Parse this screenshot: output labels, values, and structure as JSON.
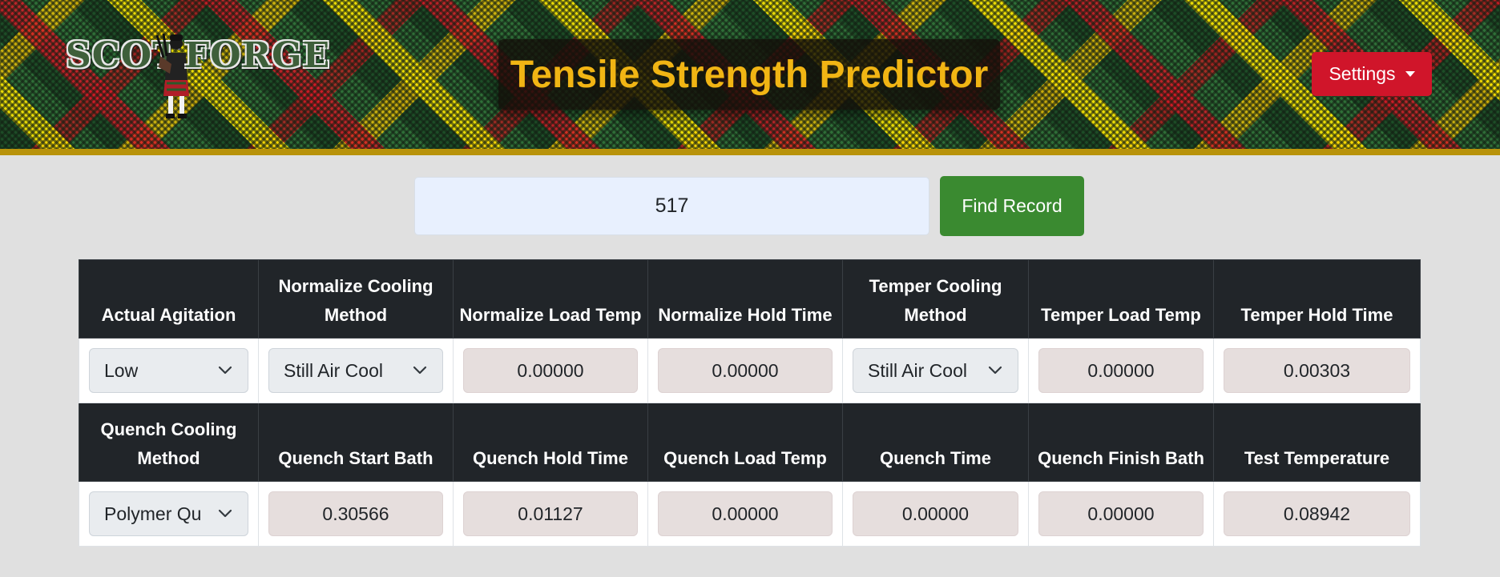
{
  "header": {
    "logo_text_left": "SCOT",
    "logo_text_right": "FORGE",
    "title": "Tensile Strength Predictor",
    "settings_label": "Settings"
  },
  "search": {
    "value": "517",
    "button_label": "Find Record"
  },
  "table": {
    "row1_headers": [
      "Actual Agitation",
      "Normalize Cooling Method",
      "Normalize Load Temp",
      "Normalize Hold Time",
      "Temper Cooling Method",
      "Temper Load Temp",
      "Temper Hold Time"
    ],
    "row1_values": [
      {
        "type": "select",
        "value": "Low"
      },
      {
        "type": "select",
        "value": "Still Air Cool"
      },
      {
        "type": "number",
        "value": "0.00000"
      },
      {
        "type": "number",
        "value": "0.00000"
      },
      {
        "type": "select",
        "value": "Still Air Cool"
      },
      {
        "type": "number",
        "value": "0.00000"
      },
      {
        "type": "number",
        "value": "0.00303"
      }
    ],
    "row2_headers": [
      "Quench Cooling Method",
      "Quench Start Bath",
      "Quench Hold Time",
      "Quench Load Temp",
      "Quench Time",
      "Quench Finish Bath",
      "Test Temperature"
    ],
    "row2_values": [
      {
        "type": "select",
        "value": "Polymer Qu"
      },
      {
        "type": "number",
        "value": "0.30566"
      },
      {
        "type": "number",
        "value": "0.01127"
      },
      {
        "type": "number",
        "value": "0.00000"
      },
      {
        "type": "number",
        "value": "0.00000"
      },
      {
        "type": "number",
        "value": "0.00000"
      },
      {
        "type": "number",
        "value": "0.08942"
      }
    ]
  },
  "colors": {
    "title_text": "#f1b514",
    "settings_button": "#d0152a",
    "find_button": "#3a8a30",
    "header_border": "#b8920a",
    "table_header_bg": "#212529",
    "page_bg": "#e0e0e0"
  },
  "icons": {
    "settings_caret": "caret-down-icon",
    "select_chevron": "chevron-down-icon",
    "logo_figure": "bagpiper-icon"
  }
}
